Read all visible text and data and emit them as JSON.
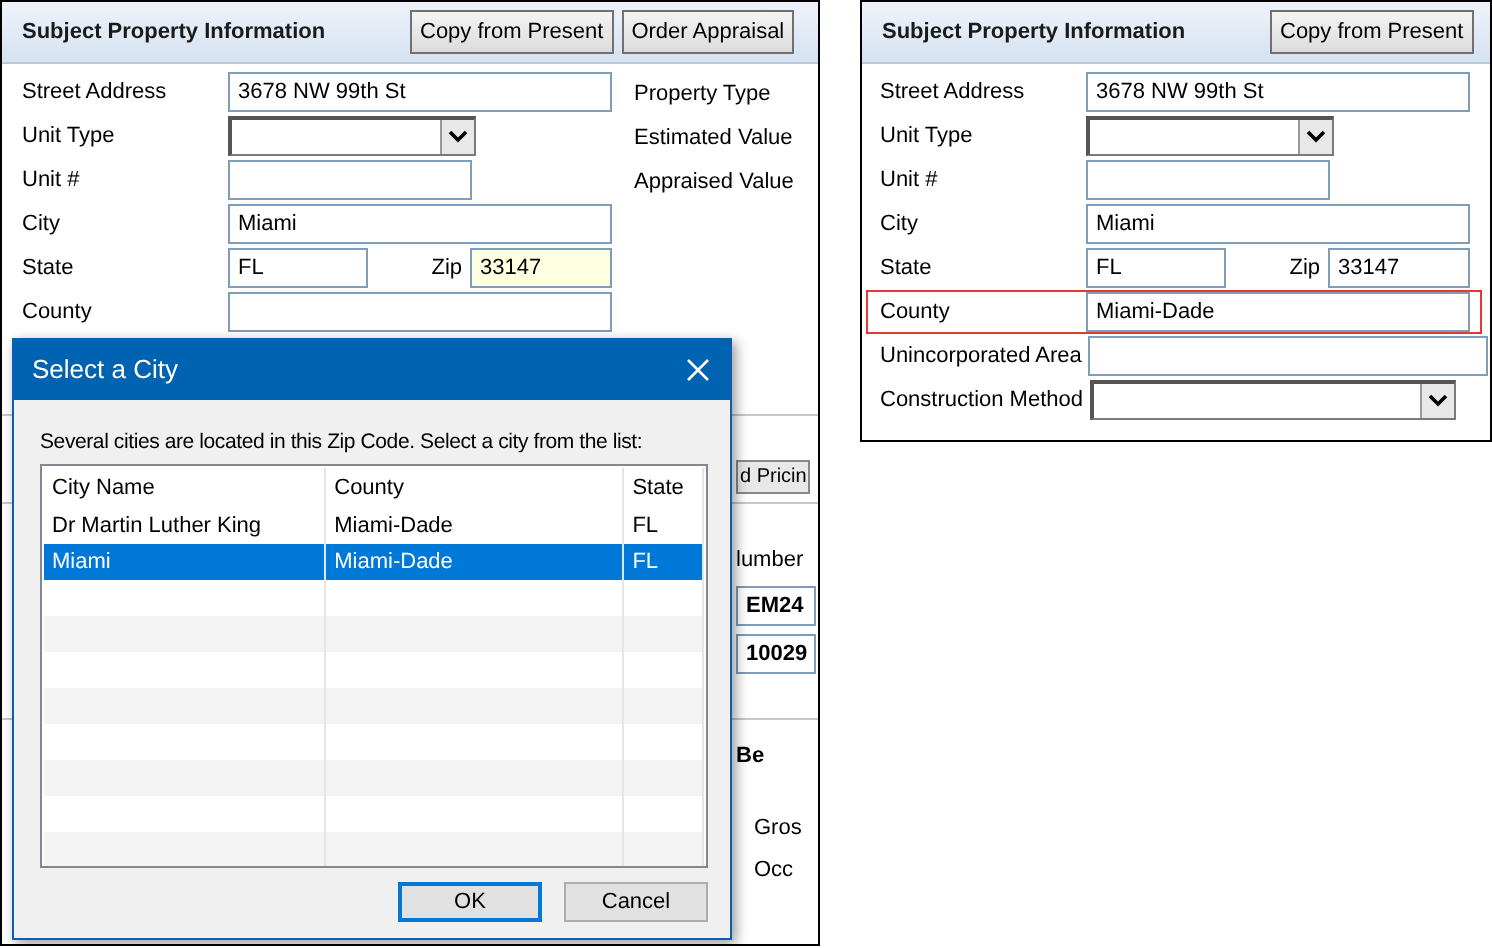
{
  "left_panel": {
    "title": "Subject Property Information",
    "buttons": [
      "Copy from Present",
      "Order Appraisal"
    ],
    "rows": [
      {
        "label": "Street Address",
        "kind": "text",
        "value": "3678 NW 99th St"
      },
      {
        "label": "Unit Type",
        "kind": "select",
        "value": ""
      },
      {
        "label": "Unit #",
        "kind": "short",
        "value": ""
      },
      {
        "label": "City",
        "kind": "text",
        "value": "Miami"
      },
      {
        "label": "State",
        "kind": "state_zip",
        "value": "FL",
        "zip_label": "Zip",
        "zip_value": "33147",
        "zip_focused": true
      },
      {
        "label": "County",
        "kind": "text",
        "value": ""
      }
    ],
    "side_labels": [
      "Property Type",
      "Estimated Value",
      "Appraised Value"
    ],
    "background_fragments": {
      "button": "d Pricin",
      "label": "lumber",
      "fields": [
        "EM24",
        "10029"
      ],
      "heading": "Be",
      "labels": [
        "Gros",
        "Occ"
      ]
    }
  },
  "dialog": {
    "title": "Select a City",
    "message": "Several cities are located in this Zip Code. Select a city from the list:",
    "columns": [
      "City Name",
      "County",
      "State"
    ],
    "rows": [
      {
        "cells": [
          "Dr Martin Luther King",
          "Miami-Dade",
          "FL"
        ],
        "selected": false
      },
      {
        "cells": [
          "Miami",
          "Miami-Dade",
          "FL"
        ],
        "selected": true
      }
    ],
    "buttons": [
      {
        "label": "OK",
        "default": true
      },
      {
        "label": "Cancel",
        "default": false
      }
    ]
  },
  "right_panel": {
    "title": "Subject Property Information",
    "buttons": [
      "Copy from Present"
    ],
    "rows": [
      {
        "label": "Street Address",
        "kind": "text",
        "value": "3678 NW 99th St",
        "outlined": false
      },
      {
        "label": "Unit Type",
        "kind": "select",
        "value": "",
        "outlined": false
      },
      {
        "label": "Unit #",
        "kind": "short",
        "value": "",
        "outlined": false
      },
      {
        "label": "City",
        "kind": "text",
        "value": "Miami",
        "outlined": false
      },
      {
        "label": "State",
        "kind": "state_zip",
        "value": "FL",
        "zip_label": "Zip",
        "zip_value": "33147",
        "zip_focused": false,
        "outlined": false
      },
      {
        "label": "County",
        "kind": "text",
        "value": "Miami-Dade",
        "outlined": true
      },
      {
        "label": "Unincorporated Area",
        "kind": "long",
        "value": "",
        "outlined": false
      },
      {
        "label": "Construction Method",
        "kind": "long_select",
        "value": "",
        "outlined": false
      }
    ]
  }
}
